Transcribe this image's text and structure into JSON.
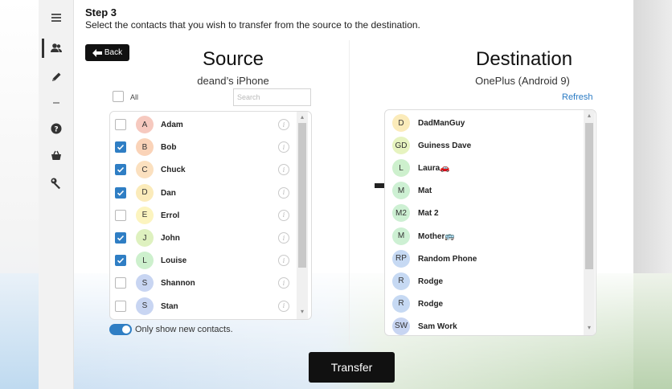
{
  "step": {
    "title": "Step 3",
    "description": "Select the contacts that you wish to transfer from the source to the destination."
  },
  "back_button": {
    "label": "Back"
  },
  "source": {
    "title": "Source",
    "device": "deand’s iPhone",
    "all_label": "All",
    "search_placeholder": "Search",
    "contacts": [
      {
        "initials": "A",
        "name": "Adam",
        "checked": false,
        "color": "#f6c9bf"
      },
      {
        "initials": "B",
        "name": "Bob",
        "checked": true,
        "color": "#fad3b8"
      },
      {
        "initials": "C",
        "name": "Chuck",
        "checked": true,
        "color": "#fbe0bf"
      },
      {
        "initials": "D",
        "name": "Dan",
        "checked": true,
        "color": "#fbebba"
      },
      {
        "initials": "E",
        "name": "Errol",
        "checked": false,
        "color": "#fcf4bf"
      },
      {
        "initials": "J",
        "name": "John",
        "checked": true,
        "color": "#def1bf"
      },
      {
        "initials": "L",
        "name": "Louise",
        "checked": true,
        "color": "#cdf0cd"
      },
      {
        "initials": "S",
        "name": "Shannon",
        "checked": false,
        "color": "#c8d5f2"
      },
      {
        "initials": "S",
        "name": "Stan",
        "checked": false,
        "color": "#c8d5f2"
      }
    ],
    "toggle_label": "Only show new contacts.",
    "toggle_on": true
  },
  "destination": {
    "title": "Destination",
    "device": "OnePlus (Android 9)",
    "refresh_label": "Refresh",
    "contacts": [
      {
        "initials": "D",
        "name": "DadManGuy",
        "emoji": "",
        "color": "#fbebba"
      },
      {
        "initials": "GD",
        "name": "Guiness Dave",
        "emoji": "",
        "color": "#e6f3bf"
      },
      {
        "initials": "L",
        "name": "Laura",
        "emoji": "🚗",
        "color": "#cdf0cd"
      },
      {
        "initials": "M",
        "name": "Mat",
        "emoji": "",
        "color": "#cdf0d3"
      },
      {
        "initials": "M2",
        "name": "Mat 2",
        "emoji": "",
        "color": "#cdf0d3"
      },
      {
        "initials": "M",
        "name": "Mother",
        "emoji": "🚌",
        "color": "#cdf0d3"
      },
      {
        "initials": "RP",
        "name": "Random Phone",
        "emoji": "",
        "color": "#c6d9f3"
      },
      {
        "initials": "R",
        "name": "Rodge",
        "emoji": "",
        "color": "#c6d9f3"
      },
      {
        "initials": "R",
        "name": "Rodge",
        "emoji": "",
        "color": "#c6d9f3"
      },
      {
        "initials": "SW",
        "name": "Sam Work",
        "emoji": "",
        "color": "#c8d5f2"
      }
    ]
  },
  "transfer_button": {
    "label": "Transfer"
  },
  "colors": {
    "accent": "#2f7ec4",
    "button_dark": "#111111",
    "link": "#2a7bc4"
  }
}
